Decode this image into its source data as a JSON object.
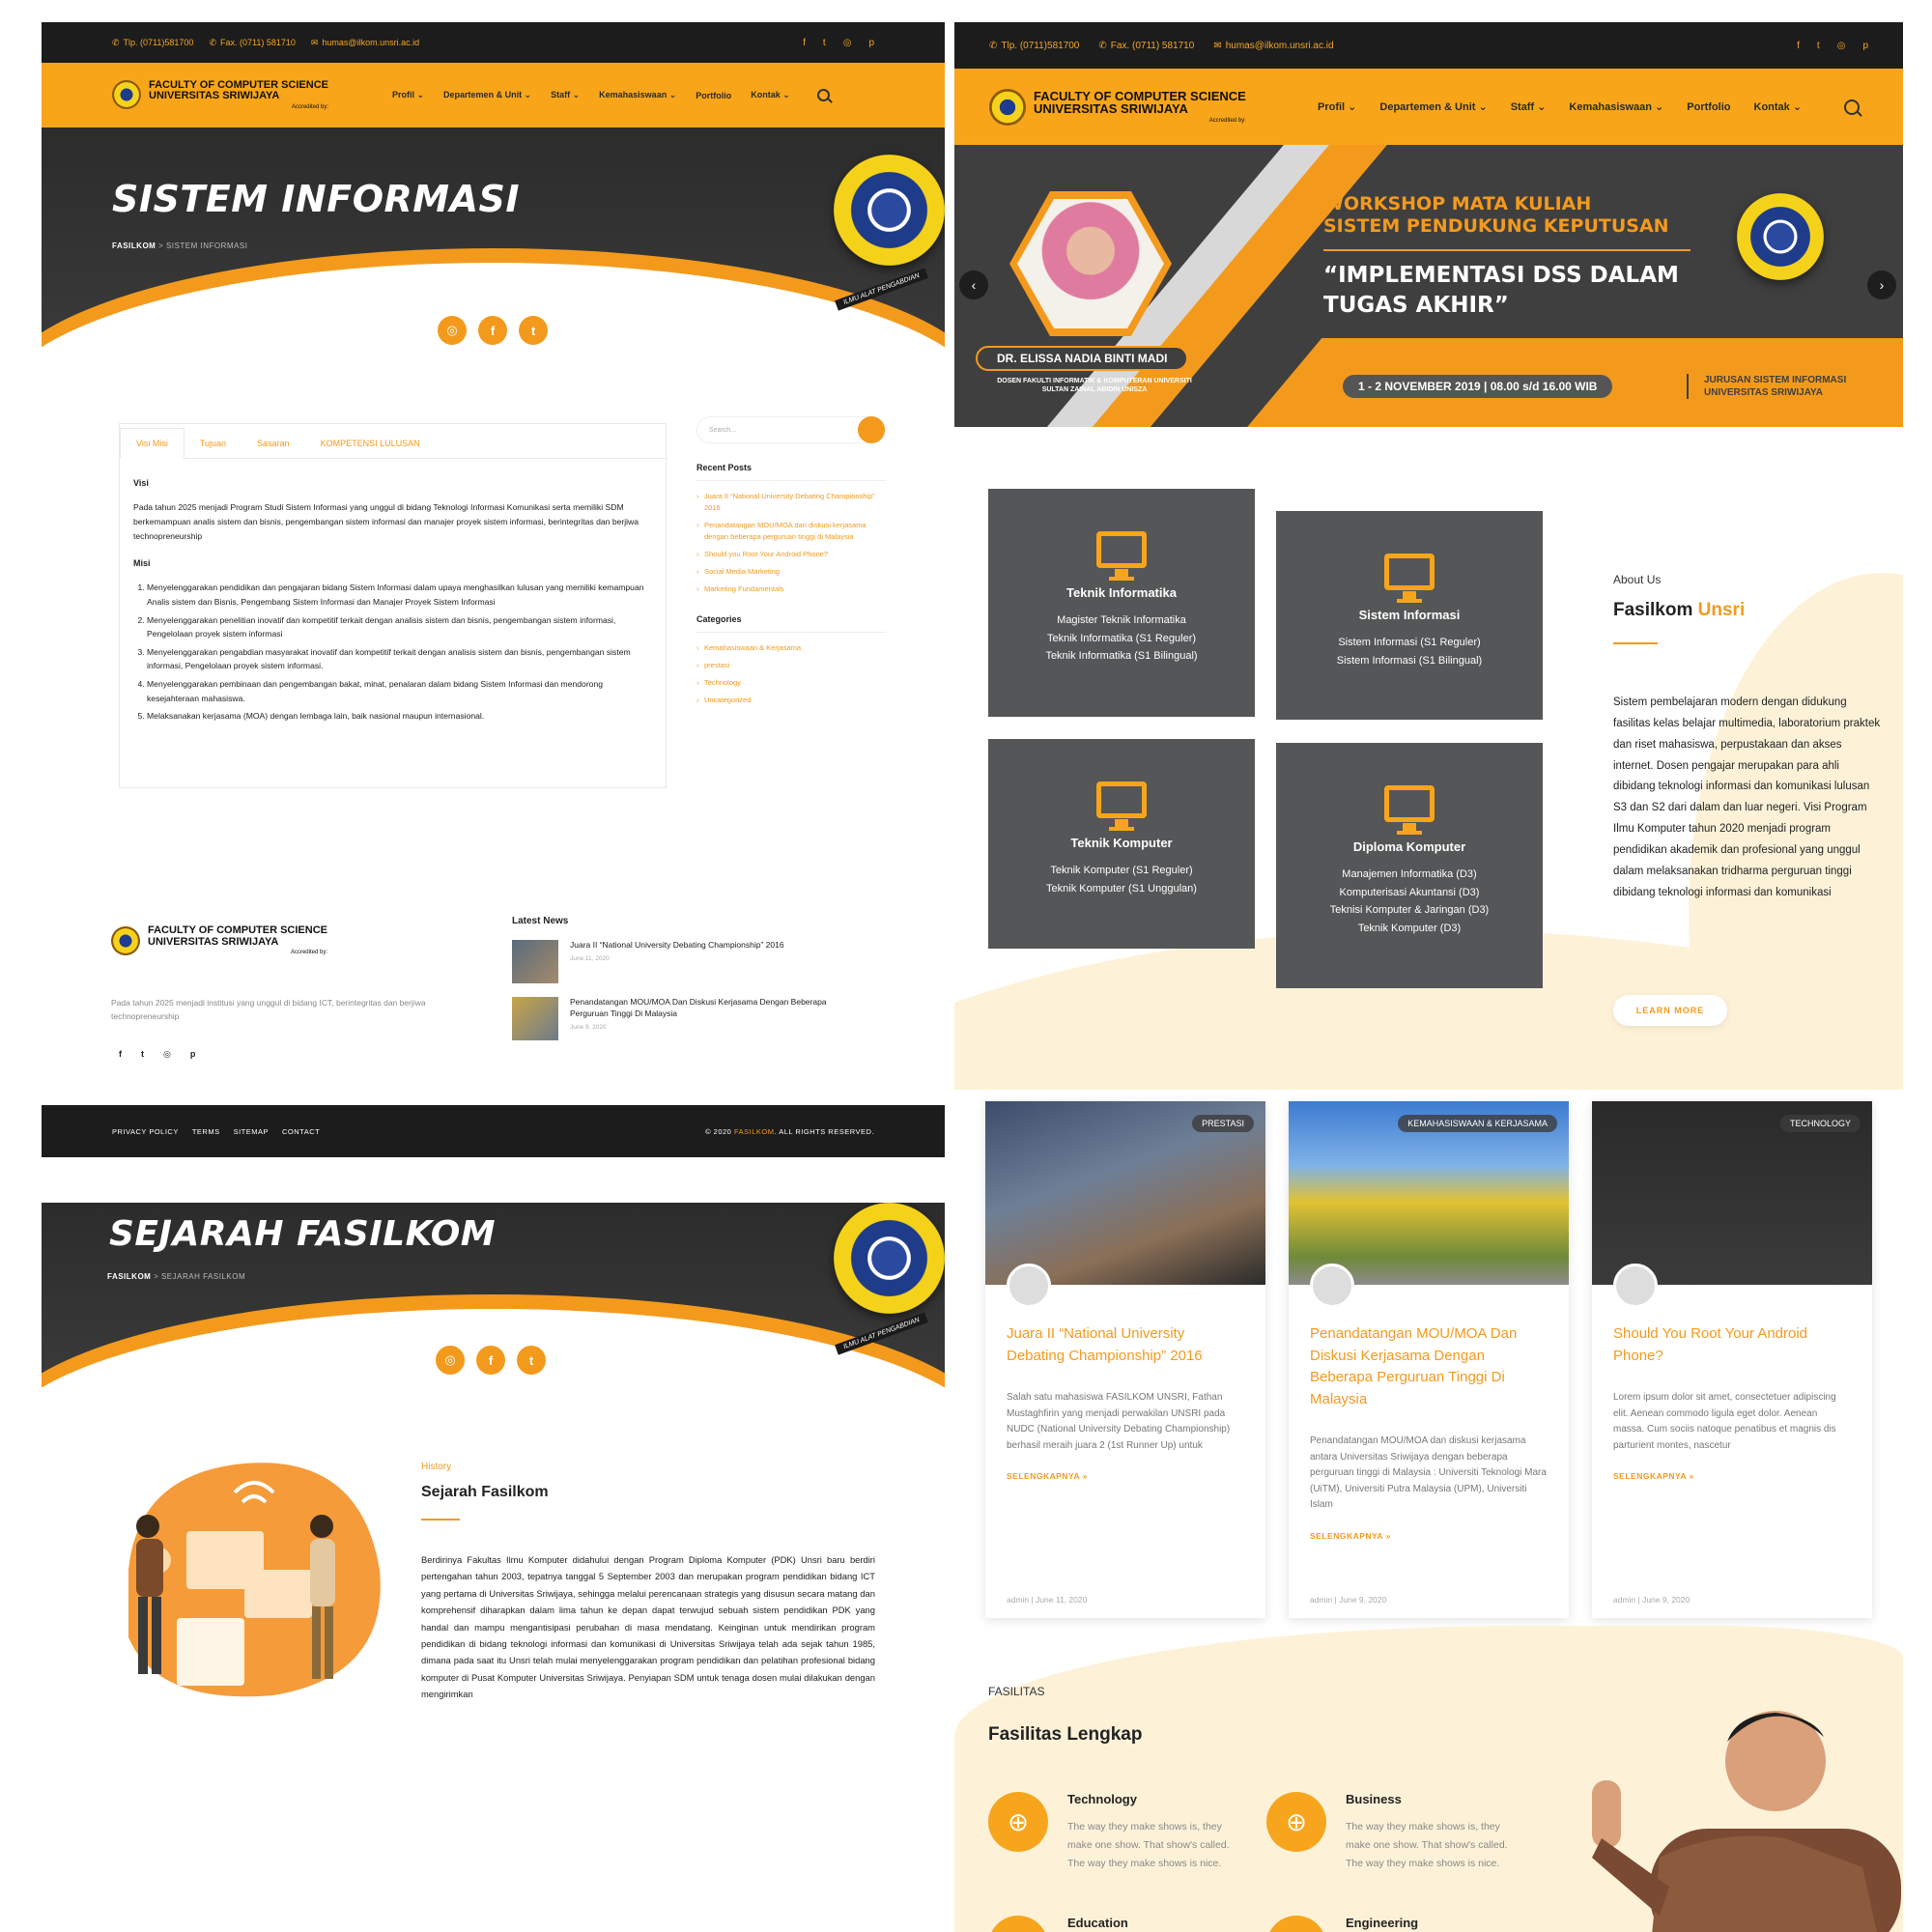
{
  "site": {
    "contact": {
      "phone": "Tlp. (0711)581700",
      "fax": "Fax. (0711) 581710",
      "email": "humas@ilkom.unsri.ac.id"
    },
    "social_icons": [
      "facebook-icon",
      "twitter-icon",
      "instagram-icon",
      "pinterest-icon"
    ],
    "brand": {
      "line1": "FACULTY OF COMPUTER SCIENCE",
      "line2": "UNIVERSITAS SRIWIJAYA",
      "accredited": "Accredited by:"
    },
    "menu": [
      "Profil ⌄",
      "Departemen & Unit ⌄",
      "Staff ⌄",
      "Kemahasiswaan ⌄",
      "Portfolio",
      "Kontak ⌄"
    ],
    "emblem_motto": "ILMU ALAT PENGABDIAN",
    "colors": {
      "accent": "#f9a51a",
      "dark": "#1c1c1c",
      "card": "#555657",
      "cream": "#fdf2d8"
    }
  },
  "si_page": {
    "title": "SISTEM INFORMASI",
    "crumb_home": "FASILKOM",
    "crumb_sep": " > ",
    "crumb_current": "SISTEM INFORMASI",
    "tabs": [
      "Visi Misi",
      "Tujuan",
      "Sasaran",
      "KOMPETENSI LULUSAN"
    ],
    "visi_heading": "Visi",
    "visi_text": "Pada tahun 2025 menjadi Program Studi Sistem Informasi yang unggul di bidang Teknologi Informasi Komunikasi serta memiliki SDM berkemampuan analis sistem dan bisnis, pengembangan sistem informasi dan manajer proyek sistem informasi, berintegritas dan berjiwa technopreneurship",
    "misi_heading": "Misi",
    "misi": [
      "Menyelenggarakan pendidikan dan pengajaran bidang Sistem Informasi dalam upaya menghasilkan lulusan yang memiliki kemampuan Analis sistem dan Bisnis, Pengembang Sistem Informasi dan Manajer Proyek Sistem Informasi",
      "Menyelenggarakan penelitian inovatif dan kompetitif terkait dengan analisis sistem dan bisnis, pengembangan sistem informasi, Pengelolaan proyek sistem informasi",
      "Menyelenggarakan pengabdian masyarakat inovatif dan kompetitif terkait dengan analisis sistem dan bisnis, pengembangan sistem informasi, Pengelolaan proyek sistem informasi.",
      "Menyelenggarakan pembinaan dan pengembangan bakat, minat, penalaran dalam bidang Sistem Informasi dan mendorong kesejahteraan mahasiswa.",
      "Melaksanakan kerjasama (MOA) dengan lembaga lain, baik nasional maupun internasional."
    ],
    "search_placeholder": "Search...",
    "recent_posts_heading": "Recent Posts",
    "recent_posts": [
      "Juara II “National University Debating Championship” 2016",
      "Penandatangan MOU/MOA dan diskusi kerjasama dengan beberapa perguruan tinggi di Malaysia",
      "Should you Root Your Android Phone?",
      "Social Media Marketing",
      "Marketing Fundamentals"
    ],
    "categories_heading": "Categories",
    "categories": [
      "Kemahasiswaan & Kerjasama",
      "prestasi",
      "Technology",
      "Uncategorized"
    ],
    "footer_text": "Pada tahun 2025 menjadi institusi yang unggul di bidang ICT, berintegritas dan berjiwa technopreneurship",
    "latest_heading": "Latest News",
    "latest_news": [
      {
        "title": "Juara II “National University Debating Championship” 2016",
        "date": "June 11, 2020"
      },
      {
        "title": "Penandatangan MOU/MOA Dan Diskusi Kerjasama Dengan Beberapa Perguruan Tinggi Di Malaysia",
        "date": "June 9, 2020"
      }
    ],
    "footer_links": [
      "PRIVACY POLICY",
      "TERMS",
      "SITEMAP",
      "CONTACT"
    ],
    "copyright_pre": "© 2020 ",
    "copyright_brand": "FASILKOM",
    "copyright_post": ". ALL RIGHTS RESERVED."
  },
  "home": {
    "slide": {
      "workshop_line1": "WORKSHOP MATA KULIAH",
      "workshop_line2": "SISTEM PENDUKUNG KEPUTUSAN",
      "quote_line1": "“IMPLEMENTASI DSS DALAM",
      "quote_line2": "TUGAS AKHIR”",
      "speaker": "DR. ELISSA NADIA BINTI MADI",
      "speaker_sub": "DOSEN FAKULTI INFORMATIK & KOMPUTERAN UNIVERSITI SULTAN ZAINAL ABIDIN UNISZA",
      "date": "1 - 2 NOVEMBER 2019 | 08.00 s/d 16.00 WIB",
      "dept_line1": "JURUSAN SISTEM INFORMASI",
      "dept_line2": "UNIVERSITAS SRIWIJAYA",
      "prev": "‹",
      "next": "›"
    },
    "programs": [
      {
        "name": "Teknik Informatika",
        "items": [
          "Magister Teknik Informatika",
          "Teknik Informatika (S1 Reguler)",
          "Teknik Informatika (S1 Bilingual)"
        ]
      },
      {
        "name": "Sistem Informasi",
        "items": [
          "Sistem Informasi (S1 Reguler)",
          "Sistem Informasi (S1 Bilingual)"
        ]
      },
      {
        "name": "Teknik Komputer",
        "items": [
          "Teknik Komputer (S1 Reguler)",
          "Teknik Komputer (S1 Unggulan)"
        ]
      },
      {
        "name": "Diploma Komputer",
        "items": [
          "Manajemen Informatika (D3)",
          "Komputerisasi Akuntansi (D3)",
          "Teknisi Komputer & Jaringan (D3)",
          "Teknik Komputer (D3)"
        ]
      }
    ],
    "about": {
      "small": "About Us",
      "title_a": "Fasilkom ",
      "title_b": "Unsri",
      "text": "Sistem pembelajaran modern dengan didukung fasilitas kelas belajar multimedia, laboratorium praktek dan riset mahasiswa, perpustakaan dan akses internet. Dosen pengajar merupakan para ahli dibidang teknologi informasi dan komunikasi lulusan S3 dan S2 dari dalam dan luar negeri. Visi Program Ilmu Komputer tahun 2020 menjadi program pendidikan akademik dan profesional yang unggul dalam melaksanakan tridharma perguruan tinggi dibidang teknologi informasi dan komunikasi",
      "button": "LEARN MORE"
    },
    "posts": [
      {
        "tag": "PRESTASI",
        "title": "Juara II “National University Debating Championship” 2016",
        "excerpt": "Salah satu mahasiswa FASILKOM UNSRI, Fathan Mustaghfirin yang menjadi  perwakilan UNSRI pada NUDC (National University Debating Championship) berhasil meraih juara 2 (1st Runner Up) untuk",
        "more": "SELENGKAPNYA »",
        "meta": "admin  |  June 11, 2020"
      },
      {
        "tag": "KEMAHASISWAAN & KERJASAMA",
        "title": "Penandatangan MOU/MOA Dan Diskusi Kerjasama Dengan Beberapa Perguruan Tinggi Di Malaysia",
        "excerpt": "Penandatangan MOU/MOA dan diskusi kerjasama antara Universitas Sriwijaya dengan beberapa perguruan tinggi di Malaysia : Universiti Teknologi Mara (UiTM), Universiti Putra Malaysia (UPM), Universiti Islam",
        "more": "SELENGKAPNYA »",
        "meta": "admin  |  June 9, 2020"
      },
      {
        "tag": "TECHNOLOGY",
        "title": "Should You Root Your Android Phone?",
        "excerpt": "Lorem ipsum dolor sit amet, consectetuer adipiscing elit. Aenean commodo ligula eget dolor. Aenean massa. Cum sociis natoque penatibus et magnis dis parturient montes, nascetur",
        "more": "SELENGKAPNYA »",
        "meta": "admin  |  June 9, 2020"
      }
    ],
    "facilities": {
      "small": "FASILITAS",
      "title": "Fasilitas Lengkap",
      "items": [
        {
          "name": "Technology",
          "text": "The way they make shows is, they make one show. That show's called. The way they make shows is nice."
        },
        {
          "name": "Business",
          "text": "The way they make shows is, they make one show. That show's called. The way they make shows is nice."
        },
        {
          "name": "Education",
          "text": ""
        },
        {
          "name": "Engineering",
          "text": ""
        }
      ]
    }
  },
  "sejarah": {
    "title": "SEJARAH FASILKOM",
    "crumb_home": "FASILKOM",
    "crumb_sep": " > ",
    "crumb_current": "SEJARAH FASILKOM",
    "small": "History",
    "heading": "Sejarah Fasilkom",
    "text": "Berdirinya Fakultas Ilmu Komputer didahului dengan Program Diploma Komputer (PDK) Unsri baru berdiri pertengahan tahun 2003, tepatnya tanggal 5 September 2003 dan merupakan program pendidikan bidang ICT yang pertama di Universitas Sriwijaya, sehingga melalui perencanaan strategis yang disusun secara matang dan komprehensif diharapkan dalam lima tahun ke depan dapat terwujud sebuah sistem pendidikan PDK yang handal dan mampu mengantisipasi perubahan di masa mendatang. Keinginan untuk mendirikan program pendidikan di bidang teknologi informasi dan komunikasi di Universitas Sriwijaya telah ada sejak tahun 1985, dimana pada saat itu Unsri telah mulai menyelenggarakan program pendidikan dan pelatihan profesional bidang komputer di Pusat Komputer Universitas Sriwijaya. Penyiapan SDM untuk tenaga dosen mulai dilakukan dengan mengirimkan"
  }
}
